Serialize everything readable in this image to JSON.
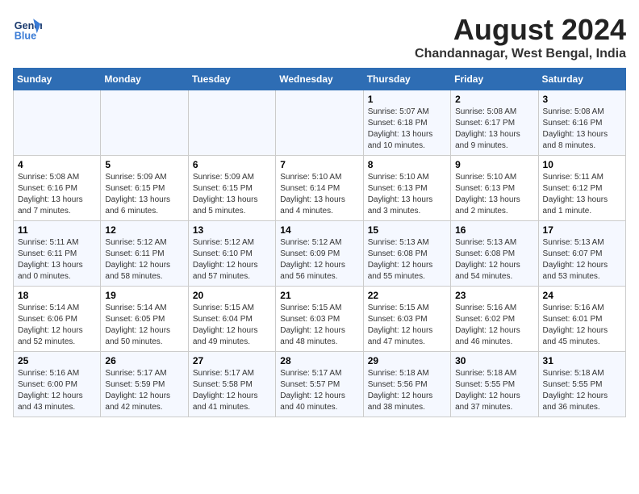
{
  "logo": {
    "line1": "General",
    "line2": "Blue"
  },
  "title": "August 2024",
  "subtitle": "Chandannagar, West Bengal, India",
  "days_of_week": [
    "Sunday",
    "Monday",
    "Tuesday",
    "Wednesday",
    "Thursday",
    "Friday",
    "Saturday"
  ],
  "weeks": [
    [
      {
        "day": "",
        "info": ""
      },
      {
        "day": "",
        "info": ""
      },
      {
        "day": "",
        "info": ""
      },
      {
        "day": "",
        "info": ""
      },
      {
        "day": "1",
        "info": "Sunrise: 5:07 AM\nSunset: 6:18 PM\nDaylight: 13 hours\nand 10 minutes."
      },
      {
        "day": "2",
        "info": "Sunrise: 5:08 AM\nSunset: 6:17 PM\nDaylight: 13 hours\nand 9 minutes."
      },
      {
        "day": "3",
        "info": "Sunrise: 5:08 AM\nSunset: 6:16 PM\nDaylight: 13 hours\nand 8 minutes."
      }
    ],
    [
      {
        "day": "4",
        "info": "Sunrise: 5:08 AM\nSunset: 6:16 PM\nDaylight: 13 hours\nand 7 minutes."
      },
      {
        "day": "5",
        "info": "Sunrise: 5:09 AM\nSunset: 6:15 PM\nDaylight: 13 hours\nand 6 minutes."
      },
      {
        "day": "6",
        "info": "Sunrise: 5:09 AM\nSunset: 6:15 PM\nDaylight: 13 hours\nand 5 minutes."
      },
      {
        "day": "7",
        "info": "Sunrise: 5:10 AM\nSunset: 6:14 PM\nDaylight: 13 hours\nand 4 minutes."
      },
      {
        "day": "8",
        "info": "Sunrise: 5:10 AM\nSunset: 6:13 PM\nDaylight: 13 hours\nand 3 minutes."
      },
      {
        "day": "9",
        "info": "Sunrise: 5:10 AM\nSunset: 6:13 PM\nDaylight: 13 hours\nand 2 minutes."
      },
      {
        "day": "10",
        "info": "Sunrise: 5:11 AM\nSunset: 6:12 PM\nDaylight: 13 hours\nand 1 minute."
      }
    ],
    [
      {
        "day": "11",
        "info": "Sunrise: 5:11 AM\nSunset: 6:11 PM\nDaylight: 13 hours\nand 0 minutes."
      },
      {
        "day": "12",
        "info": "Sunrise: 5:12 AM\nSunset: 6:11 PM\nDaylight: 12 hours\nand 58 minutes."
      },
      {
        "day": "13",
        "info": "Sunrise: 5:12 AM\nSunset: 6:10 PM\nDaylight: 12 hours\nand 57 minutes."
      },
      {
        "day": "14",
        "info": "Sunrise: 5:12 AM\nSunset: 6:09 PM\nDaylight: 12 hours\nand 56 minutes."
      },
      {
        "day": "15",
        "info": "Sunrise: 5:13 AM\nSunset: 6:08 PM\nDaylight: 12 hours\nand 55 minutes."
      },
      {
        "day": "16",
        "info": "Sunrise: 5:13 AM\nSunset: 6:08 PM\nDaylight: 12 hours\nand 54 minutes."
      },
      {
        "day": "17",
        "info": "Sunrise: 5:13 AM\nSunset: 6:07 PM\nDaylight: 12 hours\nand 53 minutes."
      }
    ],
    [
      {
        "day": "18",
        "info": "Sunrise: 5:14 AM\nSunset: 6:06 PM\nDaylight: 12 hours\nand 52 minutes."
      },
      {
        "day": "19",
        "info": "Sunrise: 5:14 AM\nSunset: 6:05 PM\nDaylight: 12 hours\nand 50 minutes."
      },
      {
        "day": "20",
        "info": "Sunrise: 5:15 AM\nSunset: 6:04 PM\nDaylight: 12 hours\nand 49 minutes."
      },
      {
        "day": "21",
        "info": "Sunrise: 5:15 AM\nSunset: 6:03 PM\nDaylight: 12 hours\nand 48 minutes."
      },
      {
        "day": "22",
        "info": "Sunrise: 5:15 AM\nSunset: 6:03 PM\nDaylight: 12 hours\nand 47 minutes."
      },
      {
        "day": "23",
        "info": "Sunrise: 5:16 AM\nSunset: 6:02 PM\nDaylight: 12 hours\nand 46 minutes."
      },
      {
        "day": "24",
        "info": "Sunrise: 5:16 AM\nSunset: 6:01 PM\nDaylight: 12 hours\nand 45 minutes."
      }
    ],
    [
      {
        "day": "25",
        "info": "Sunrise: 5:16 AM\nSunset: 6:00 PM\nDaylight: 12 hours\nand 43 minutes."
      },
      {
        "day": "26",
        "info": "Sunrise: 5:17 AM\nSunset: 5:59 PM\nDaylight: 12 hours\nand 42 minutes."
      },
      {
        "day": "27",
        "info": "Sunrise: 5:17 AM\nSunset: 5:58 PM\nDaylight: 12 hours\nand 41 minutes."
      },
      {
        "day": "28",
        "info": "Sunrise: 5:17 AM\nSunset: 5:57 PM\nDaylight: 12 hours\nand 40 minutes."
      },
      {
        "day": "29",
        "info": "Sunrise: 5:18 AM\nSunset: 5:56 PM\nDaylight: 12 hours\nand 38 minutes."
      },
      {
        "day": "30",
        "info": "Sunrise: 5:18 AM\nSunset: 5:55 PM\nDaylight: 12 hours\nand 37 minutes."
      },
      {
        "day": "31",
        "info": "Sunrise: 5:18 AM\nSunset: 5:55 PM\nDaylight: 12 hours\nand 36 minutes."
      }
    ]
  ]
}
